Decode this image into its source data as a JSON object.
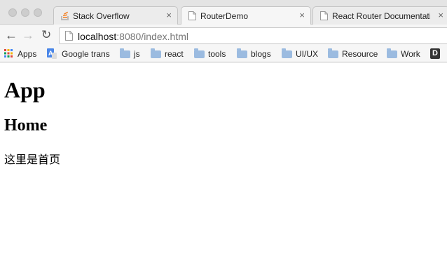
{
  "tabs": [
    {
      "title": "Stack Overflow",
      "close": "×",
      "favicon": "stackoverflow-icon"
    },
    {
      "title": "RouterDemo",
      "close": "×",
      "favicon": "page-icon"
    },
    {
      "title": "React Router Documentatio",
      "close": "×",
      "favicon": "page-icon"
    }
  ],
  "toolbar": {
    "back": "←",
    "forward": "→",
    "reload": "↻",
    "url_host": "localhost",
    "url_rest": ":8080/index.html"
  },
  "bookmarks": [
    {
      "label": "Apps",
      "icon": "apps-grid-icon"
    },
    {
      "label": "Google trans",
      "icon": "google-translate-icon"
    },
    {
      "label": "js",
      "icon": "folder-icon"
    },
    {
      "label": "react",
      "icon": "folder-icon"
    },
    {
      "label": "tools",
      "icon": "folder-icon"
    },
    {
      "label": "blogs",
      "icon": "folder-icon"
    },
    {
      "label": "UI/UX",
      "icon": "folder-icon"
    },
    {
      "label": "Resource",
      "icon": "folder-icon"
    },
    {
      "label": "Work",
      "icon": "folder-icon"
    },
    {
      "label": "D",
      "icon": "d-badge-icon"
    }
  ],
  "page": {
    "heading": "App",
    "subheading": "Home",
    "text": "这里是首页"
  },
  "colors": {
    "folder": "#9bbbe0",
    "chrome": "#f2f2f2",
    "tabstrip": "#e4e4e4"
  }
}
